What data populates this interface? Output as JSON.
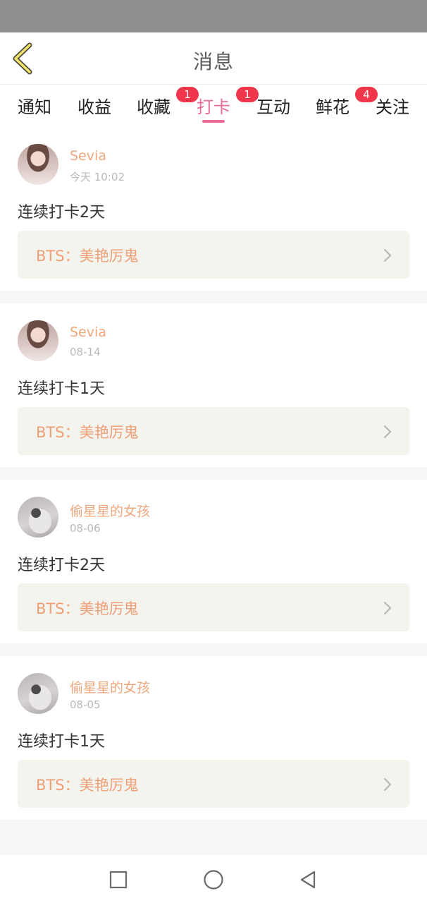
{
  "header": {
    "title": "消息"
  },
  "tabs": [
    {
      "label": "通知"
    },
    {
      "label": "收益"
    },
    {
      "label": "收藏",
      "badge": "1"
    },
    {
      "label": "打卡",
      "badge": "1",
      "active": true
    },
    {
      "label": "互动"
    },
    {
      "label": "鲜花",
      "badge": "4"
    },
    {
      "label": "关注"
    }
  ],
  "feed": [
    {
      "username": "Sevia",
      "time": "今天 10:02",
      "message": "连续打卡2天",
      "topic": "BTS：美艳厉鬼",
      "avatar": "girl"
    },
    {
      "username": "Sevia",
      "time": "08-14",
      "message": "连续打卡1天",
      "topic": "BTS：美艳厉鬼",
      "avatar": "girl"
    },
    {
      "username": "偷星星的女孩",
      "time": "08-06",
      "message": "连续打卡2天",
      "topic": "BTS：美艳厉鬼",
      "avatar": "grey"
    },
    {
      "username": "偷星星的女孩",
      "time": "08-05",
      "message": "连续打卡1天",
      "topic": "BTS：美艳厉鬼",
      "avatar": "grey"
    }
  ],
  "colors": {
    "accent_pink": "#e86b9a",
    "badge_red": "#f0364b",
    "username_orange": "#f0a77c",
    "topic_orange": "#ef9f78",
    "topic_bg": "#f4f4ee"
  },
  "icons": {
    "back": "chevron-left-icon",
    "topic_arrow": "chevron-right-icon",
    "nav_recent": "square-icon",
    "nav_home": "circle-icon",
    "nav_back": "triangle-back-icon"
  }
}
